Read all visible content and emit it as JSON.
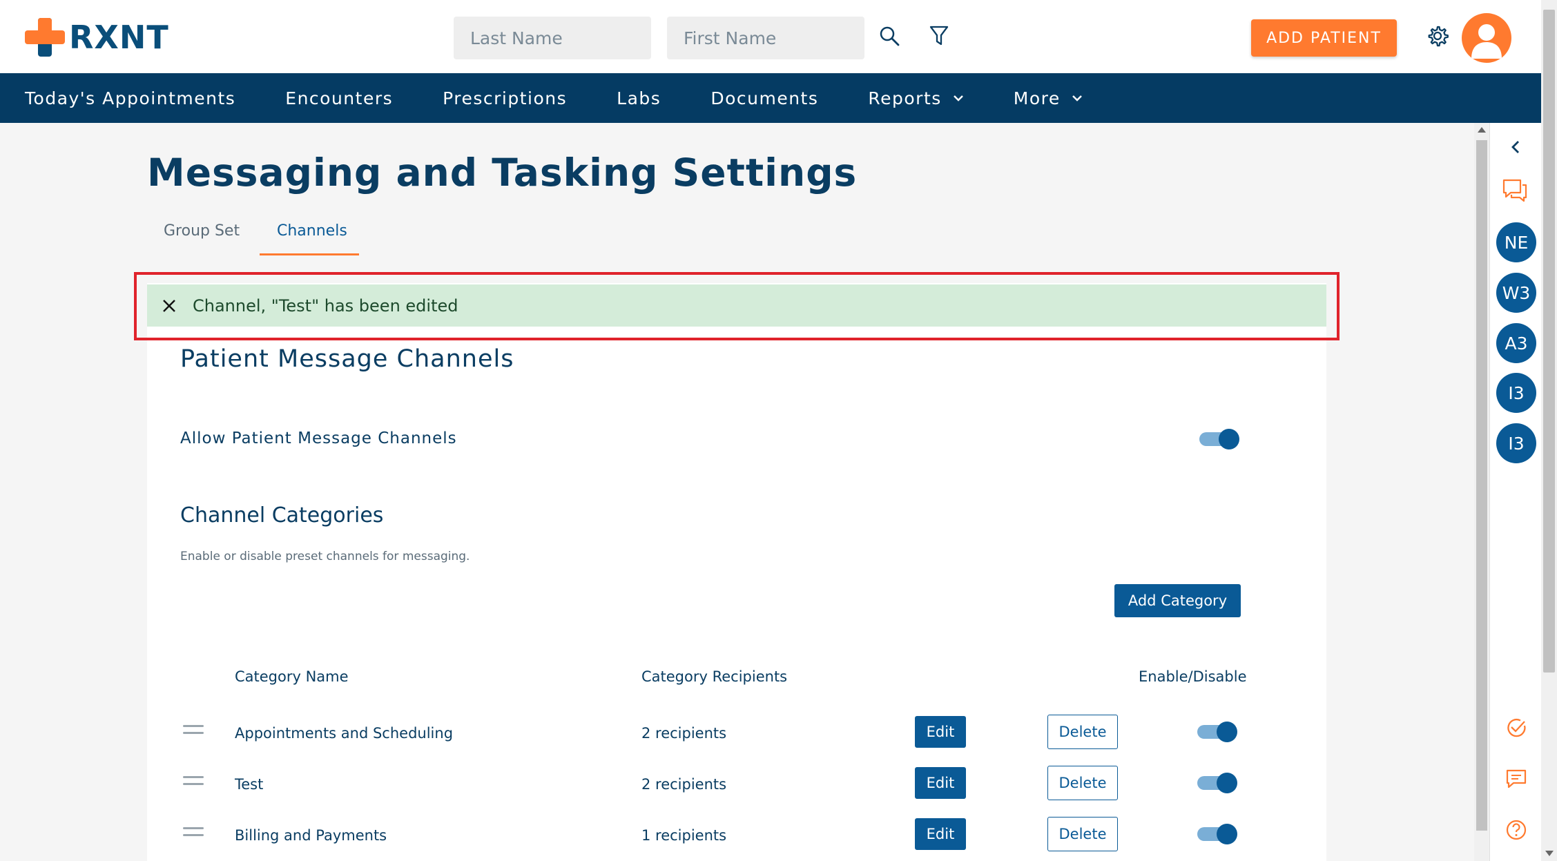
{
  "header": {
    "logo_text": "RXNT",
    "last_name_placeholder": "Last Name",
    "first_name_placeholder": "First Name",
    "add_patient_label": "ADD PATIENT",
    "accent_color": "#ff7a2f",
    "brand_color": "#0a4e7a"
  },
  "nav": {
    "items": [
      {
        "label": "Today's Appointments"
      },
      {
        "label": "Encounters"
      },
      {
        "label": "Prescriptions"
      },
      {
        "label": "Labs"
      },
      {
        "label": "Documents"
      },
      {
        "label": "Reports",
        "dropdown": true
      },
      {
        "label": "More",
        "dropdown": true
      }
    ]
  },
  "page": {
    "title": "Messaging and Tasking Settings",
    "tabs": [
      {
        "label": "Group Set",
        "active": false
      },
      {
        "label": "Channels",
        "active": true
      }
    ]
  },
  "alert": {
    "message": "Channel, \"Test\" has been edited"
  },
  "section": {
    "title": "Patient Message Channels",
    "allow_label": "Allow Patient Message Channels",
    "allow_enabled": true,
    "categories_title": "Channel Categories",
    "categories_desc": "Enable or disable preset channels for messaging.",
    "add_category_label": "Add Category"
  },
  "table": {
    "headers": {
      "name": "Category Name",
      "recipients": "Category Recipients",
      "toggle": "Enable/Disable"
    },
    "edit_label": "Edit",
    "delete_label": "Delete",
    "rows": [
      {
        "name": "Appointments and Scheduling",
        "recipients": "2 recipients",
        "enabled": true
      },
      {
        "name": "Test",
        "recipients": "2 recipients",
        "enabled": true
      },
      {
        "name": "Billing and Payments",
        "recipients": "1 recipients",
        "enabled": true
      }
    ]
  },
  "sidebar": {
    "users": [
      "NE",
      "W3",
      "A3",
      "I3",
      "I3"
    ]
  }
}
